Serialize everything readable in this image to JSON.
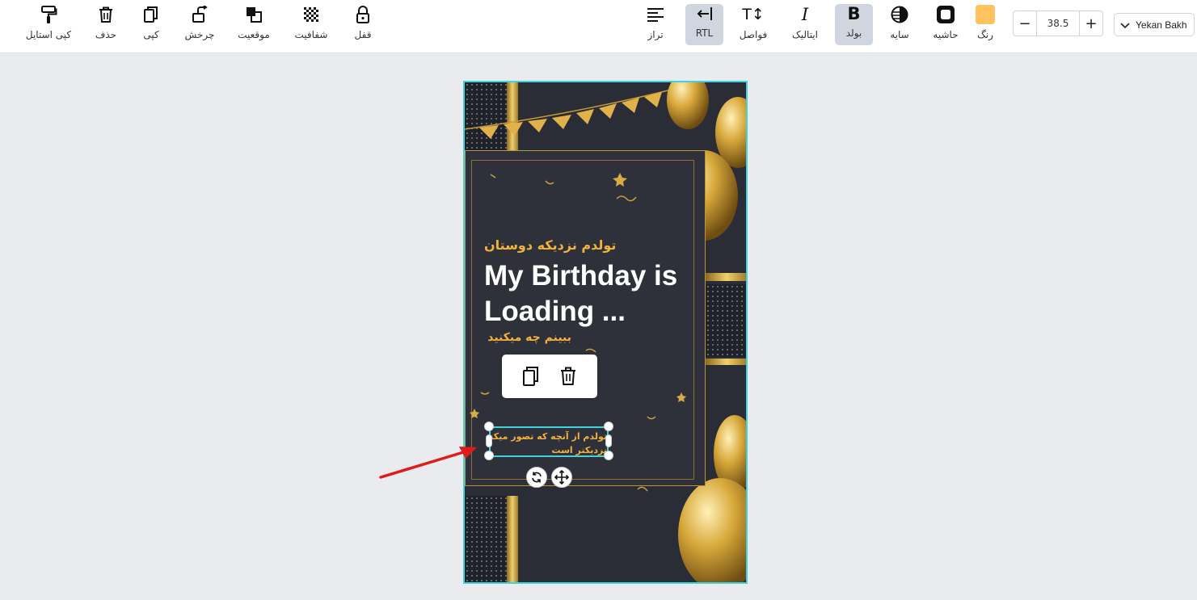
{
  "toolbar": {
    "left_tools": [
      {
        "label": "کپی استایل",
        "icon": "paint-roller-icon"
      },
      {
        "label": "حذف",
        "icon": "trash-icon"
      },
      {
        "label": "کپی",
        "icon": "copy-icon"
      },
      {
        "label": "چرخش",
        "icon": "rotate-icon"
      },
      {
        "label": "موقعیت",
        "icon": "layers-icon"
      },
      {
        "label": "شفافیت",
        "icon": "checkerboard-icon"
      },
      {
        "label": "قفل",
        "icon": "lock-icon"
      }
    ],
    "align_label": "تراز",
    "rtl_label": "RTL",
    "spacing_label": "فواصل",
    "spacing_glyph": "T↕",
    "italic_label": "ایتالیک",
    "italic_glyph": "I",
    "bold_label": "بولد",
    "bold_glyph": "B",
    "shadow_label": "سایه",
    "stroke_label": "حاشیه",
    "color_label": "رنگ",
    "color_value": "#ffc25c",
    "font_size": "38.5",
    "minus": "−",
    "plus": "+",
    "font_family": "Yekan Bakh"
  },
  "design": {
    "title_fa": "تولدم نزدیکه دوستان",
    "title_en": "My Birthday is Loading ...",
    "subtitle_fa": "ببینم چه میکنید",
    "selected_text_line1": "تولدم از آنچه که تصور میکنید",
    "selected_text_line2": "نزدیکتر است"
  },
  "colors": {
    "accent": "#40d3dd",
    "gold": "#f2b23c",
    "bg": "#e9ebee",
    "active_tool": "#cfd6e0",
    "arrow": "#e01b1b"
  }
}
